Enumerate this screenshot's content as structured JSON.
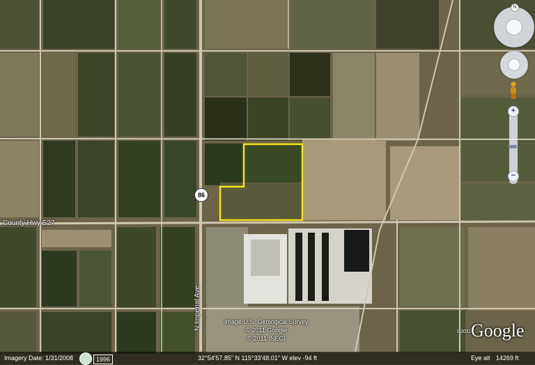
{
  "map": {
    "road_labels": {
      "county_hwy": "County Hwy S27",
      "imperial_ave": "N Imperial Ave",
      "route_shield": "86"
    },
    "attribution": {
      "line1": "Image U.S. Geological Survey",
      "line2": "© 2011 Google",
      "line3": "© 2011 INEGI"
    },
    "brand": "Google",
    "brand_year": "©2011",
    "highlight_color": "#f2e21a"
  },
  "statusbar": {
    "imagery_date": "Imagery Date: 1/31/2008",
    "year": "1996",
    "coordinates": "32°54'57.85\" N 115°33'48.01\" W elev  -94 ft",
    "eye_alt_label": "Eye alt",
    "eye_alt_value": "14269 ft"
  },
  "controls": {
    "north_label": "N",
    "zoom_in": "+",
    "zoom_out": "−",
    "zoom_level": 0.55,
    "icons": [
      "look-around-icon",
      "move-hand-icon",
      "pegman-icon"
    ]
  }
}
